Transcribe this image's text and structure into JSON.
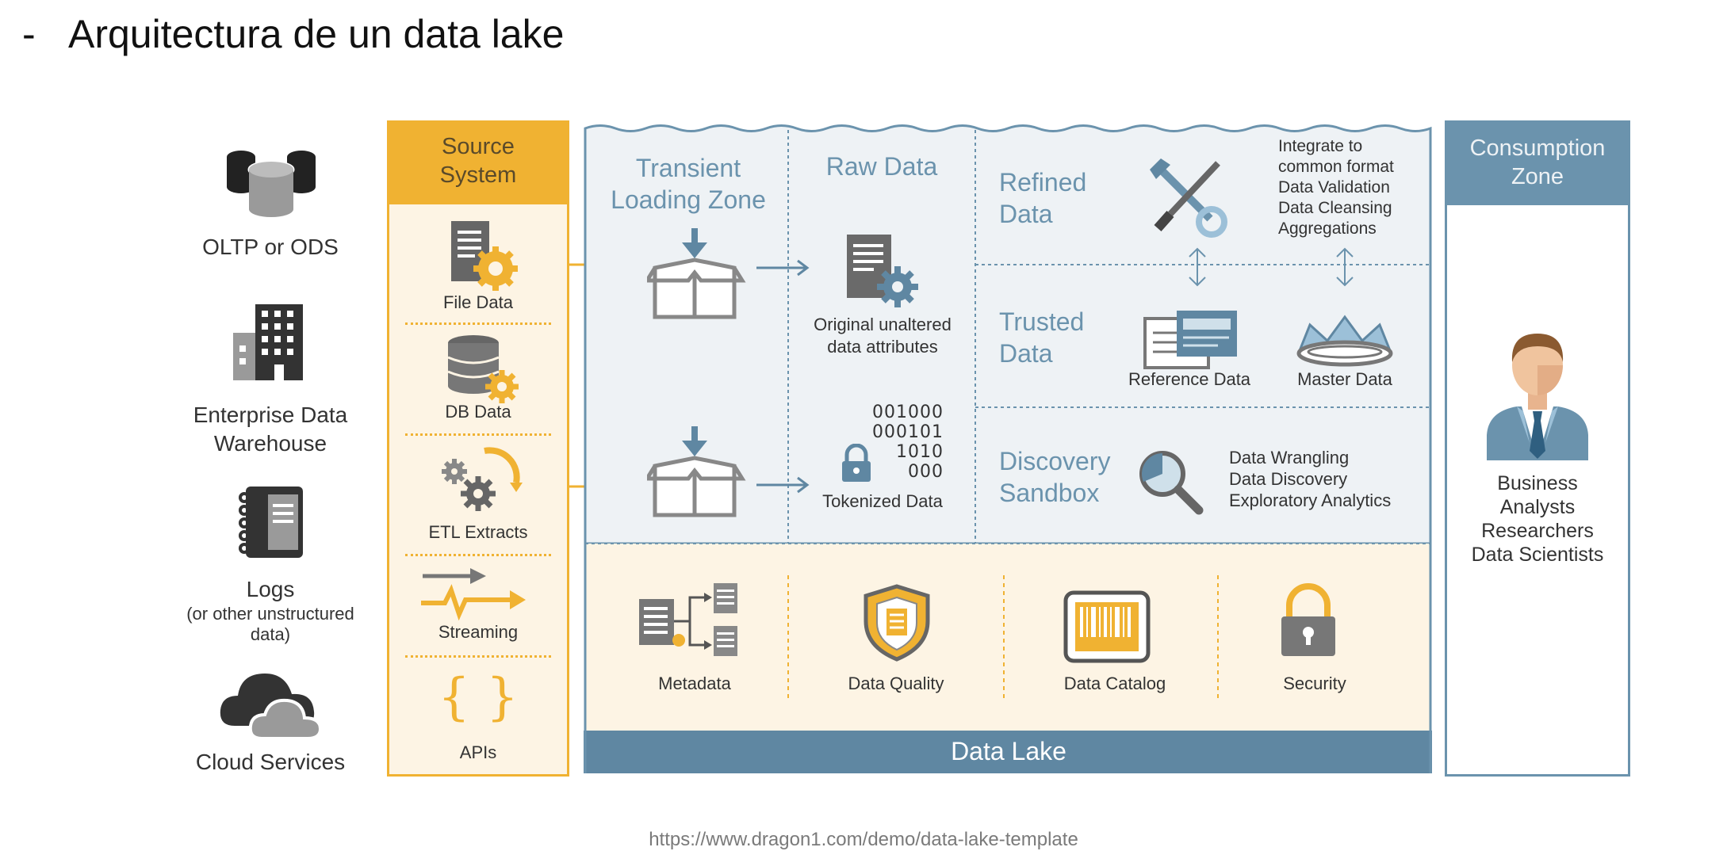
{
  "slide": {
    "bullet": "-",
    "title": "Arquitectura de un data lake"
  },
  "sources": {
    "oltp": "OLTP or ODS",
    "edw_1": "Enterprise Data",
    "edw_2": "Warehouse",
    "logs": "Logs",
    "logs_sub_1": "(or other unstructured",
    "logs_sub_2": "data)",
    "cloud": "Cloud Services"
  },
  "source_system": {
    "title_1": "Source",
    "title_2": "System",
    "items": [
      "File Data",
      "DB Data",
      "ETL Extracts",
      "Streaming",
      "APIs"
    ]
  },
  "lake": {
    "transient_1": "Transient",
    "transient_2": "Loading Zone",
    "raw": "Raw Data",
    "raw_caption_1": "Original unaltered",
    "raw_caption_2": "data attributes",
    "binary": [
      "001000",
      "000101",
      "1010",
      "000"
    ],
    "tokenized": "Tokenized Data",
    "refined_1": "Refined",
    "refined_2": "Data",
    "refined_notes": [
      "Integrate to",
      "common format",
      "Data Validation",
      "Data Cleansing",
      "Aggregations"
    ],
    "trusted_1": "Trusted",
    "trusted_2": "Data",
    "reference": "Reference Data",
    "master": "Master Data",
    "discovery_1": "Discovery",
    "discovery_2": "Sandbox",
    "discovery_notes": [
      "Data Wrangling",
      "Data Discovery",
      "Exploratory Analytics"
    ],
    "governance": [
      "Metadata",
      "Data Quality",
      "Data Catalog",
      "Security"
    ],
    "footer": "Data Lake"
  },
  "consumption": {
    "title_1": "Consumption",
    "title_2": "Zone",
    "users": [
      "Business",
      "Analysts",
      "Researchers",
      "Data Scientists"
    ]
  },
  "source_url": "https://www.dragon1.com/demo/data-lake-template",
  "colors": {
    "orange": "#f0b232",
    "blue": "#5f87a2",
    "lake_bg": "#eef2f5",
    "cream": "#fdf4e4"
  }
}
